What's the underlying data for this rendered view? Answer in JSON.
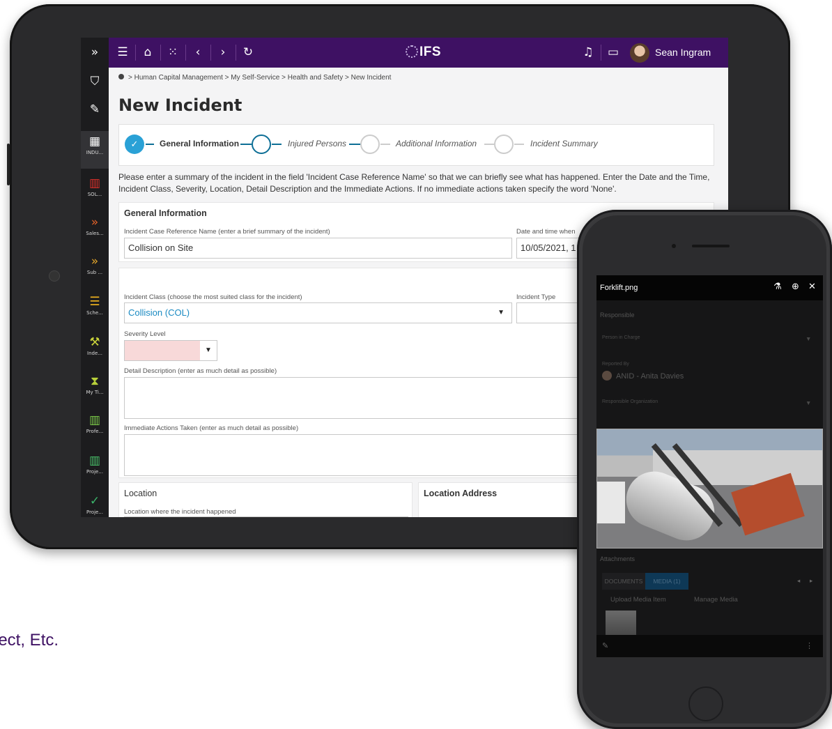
{
  "sidebar": {
    "items": [
      {
        "icon": "double-chevron-right-icon",
        "glyph": "»",
        "label": "",
        "color": "#ffffff"
      },
      {
        "icon": "bookmark-icon",
        "glyph": "⛉",
        "label": "",
        "color": "#ffffff"
      },
      {
        "icon": "pencil-icon",
        "glyph": "✎",
        "label": "",
        "color": "#ffffff"
      },
      {
        "icon": "grid-icon",
        "glyph": "▦",
        "label": "INDU...",
        "color": "#ffffff"
      },
      {
        "icon": "bar-chart-icon",
        "glyph": "▥",
        "label": "SOL...",
        "color": "#e0302a"
      },
      {
        "icon": "double-chevron-right-icon",
        "glyph": "»",
        "label": "Sales...",
        "color": "#e8642a"
      },
      {
        "icon": "double-chevron-right-icon",
        "glyph": "»",
        "label": "Sub ...",
        "color": "#e8a82a"
      },
      {
        "icon": "schedule-icon",
        "glyph": "☰",
        "label": "Sche...",
        "color": "#f2b51e"
      },
      {
        "icon": "gavel-icon",
        "glyph": "⚒",
        "label": "Inde...",
        "color": "#c9d23a"
      },
      {
        "icon": "hourglass-icon",
        "glyph": "⧗",
        "label": "My Ti...",
        "color": "#b7cf3a"
      },
      {
        "icon": "bar-chart-icon",
        "glyph": "▥",
        "label": "Profe...",
        "color": "#7fd04a"
      },
      {
        "icon": "bar-chart-icon",
        "glyph": "▥",
        "label": "Proje...",
        "color": "#49c26a"
      },
      {
        "icon": "check-icon",
        "glyph": "✓",
        "label": "Proje...",
        "color": "#3bb56b"
      }
    ]
  },
  "topbar": {
    "logo": "IFS",
    "user_name": "Sean Ingram"
  },
  "breadcrumb": "> Human Capital Management > My Self-Service > Health and Safety > New Incident",
  "page_title": "New Incident",
  "wizard": {
    "steps": [
      {
        "label": "General Information",
        "state": "done"
      },
      {
        "label": "Injured Persons",
        "state": "current"
      },
      {
        "label": "Additional Information",
        "state": "open"
      },
      {
        "label": "Incident Summary",
        "state": "open"
      }
    ]
  },
  "instructions": "Please enter a summary of the incident in the field 'Incident Case Reference Name' so that we can briefly see what has happened. Enter the Date and the Time, Incident Class, Severity, Location, Detail Description and the Immediate Actions. If no immediate actions taken specify the word 'None'.",
  "general": {
    "section_title": "General Information",
    "ref_label": "Incident Case Reference Name (enter a brief summary of the incident)",
    "ref_value": "Collision on Site",
    "date_label": "Date and time when",
    "date_value": "10/05/2021, 1"
  },
  "classification": {
    "class_label": "Incident Class (choose the most suited class for the incident)",
    "class_value": "Collision (COL)",
    "type_label": "Incident Type",
    "severity_label": "Severity Level",
    "detail_label": "Detail Description (enter as much detail as possible)",
    "actions_label": "Immediate Actions Taken (enter as much detail as possible)"
  },
  "location": {
    "title": "Location",
    "address_title": "Location Address",
    "where_label": "Location where the incident happened"
  },
  "background_text": "ject, Etc.",
  "phone": {
    "file_name": "Forklift.png",
    "responsible_label": "Responsible",
    "person_in_charge": "Person in Charge",
    "reported_by_label": "Reported By",
    "reported_by_value": "ANID - Anita Davies",
    "responsible_org": "Responsible Organization",
    "attachments_label": "Attachments",
    "tab_documents": "DOCUMENTS",
    "tab_media": "MEDIA (1)",
    "upload_btn": "Upload Media Item",
    "manage_btn": "Manage Media"
  }
}
